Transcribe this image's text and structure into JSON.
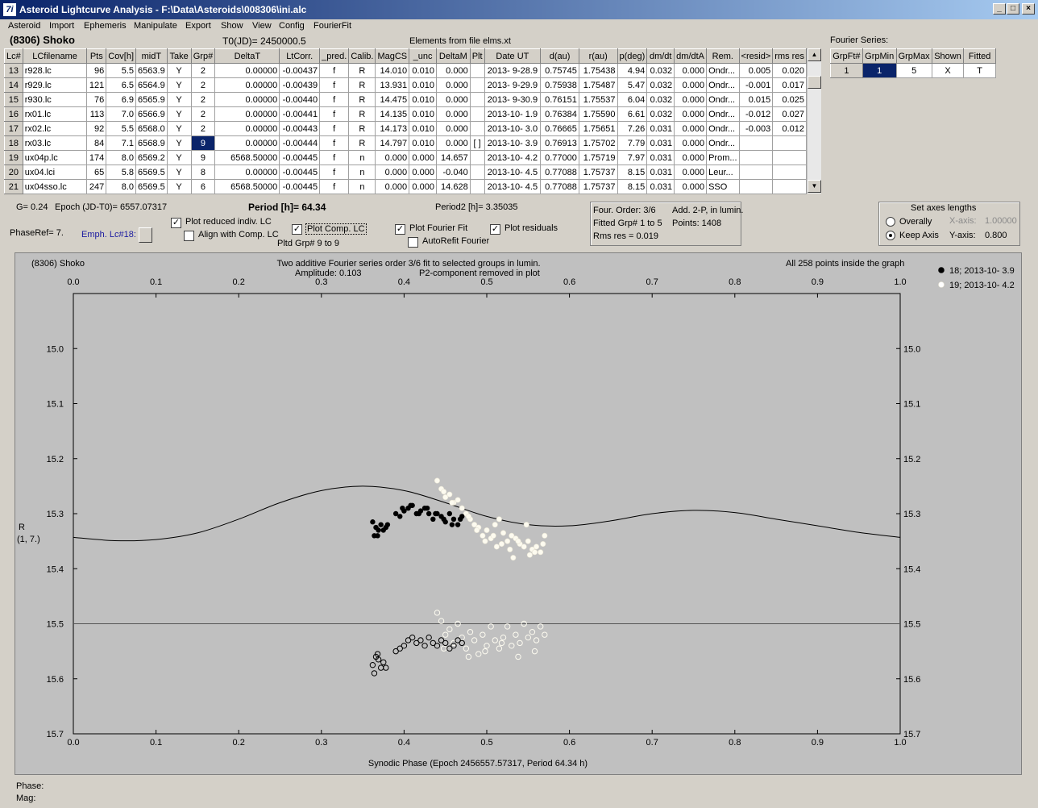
{
  "window": {
    "title": "Asteroid Lightcurve Analysis - F:\\Data\\Asteroids\\008306\\ini.alc",
    "icon_glyph": "7i"
  },
  "menu": [
    "Asteroid",
    "Import",
    "Ephemeris",
    "Manipulate",
    "Export",
    "Show",
    "View",
    "Config",
    "FourierFit"
  ],
  "header": {
    "asteroid": "(8306) Shoko",
    "t0": "T0(JD)= 2450000.5",
    "elements": "Elements from file elms.xt",
    "fourier_series_label": "Fourier Series:"
  },
  "lc_table": {
    "columns": [
      "Lc#",
      "LCfilename",
      "Pts",
      "Cov[h]",
      "midT",
      "Take",
      "Grp#",
      "DeltaT",
      "LtCorr.",
      "_pred.",
      "Calib.",
      "MagCS",
      "_unc",
      "DeltaM",
      "Plt",
      "Date UT",
      "d(au)",
      "r(au)",
      "p(deg)",
      "dm/dt",
      "dm/dtA",
      "Rem.",
      "<resid>",
      "rms res"
    ],
    "rows": [
      [
        "13",
        "r928.lc",
        "96",
        "5.5",
        "6563.9",
        "Y",
        "2",
        "0.00000",
        "-0.00437",
        "f",
        "R",
        "14.010",
        "0.010",
        "0.000",
        "",
        "2013- 9-28.9",
        "0.75745",
        "1.75438",
        "4.94",
        "0.032",
        "0.000",
        "Ondr...",
        "0.005",
        "0.020"
      ],
      [
        "14",
        "r929.lc",
        "121",
        "6.5",
        "6564.9",
        "Y",
        "2",
        "0.00000",
        "-0.00439",
        "f",
        "R",
        "13.931",
        "0.010",
        "0.000",
        "",
        "2013- 9-29.9",
        "0.75938",
        "1.75487",
        "5.47",
        "0.032",
        "0.000",
        "Ondr...",
        "-0.001",
        "0.017"
      ],
      [
        "15",
        "r930.lc",
        "76",
        "6.9",
        "6565.9",
        "Y",
        "2",
        "0.00000",
        "-0.00440",
        "f",
        "R",
        "14.475",
        "0.010",
        "0.000",
        "",
        "2013- 9-30.9",
        "0.76151",
        "1.75537",
        "6.04",
        "0.032",
        "0.000",
        "Ondr...",
        "0.015",
        "0.025"
      ],
      [
        "16",
        "rx01.lc",
        "113",
        "7.0",
        "6566.9",
        "Y",
        "2",
        "0.00000",
        "-0.00441",
        "f",
        "R",
        "14.135",
        "0.010",
        "0.000",
        "",
        "2013-10- 1.9",
        "0.76384",
        "1.75590",
        "6.61",
        "0.032",
        "0.000",
        "Ondr...",
        "-0.012",
        "0.027"
      ],
      [
        "17",
        "rx02.lc",
        "92",
        "5.5",
        "6568.0",
        "Y",
        "2",
        "0.00000",
        "-0.00443",
        "f",
        "R",
        "14.173",
        "0.010",
        "0.000",
        "",
        "2013-10- 3.0",
        "0.76665",
        "1.75651",
        "7.26",
        "0.031",
        "0.000",
        "Ondr...",
        "-0.003",
        "0.012"
      ],
      [
        "18",
        "rx03.lc",
        "84",
        "7.1",
        "6568.9",
        "Y",
        "9",
        "0.00000",
        "-0.00444",
        "f",
        "R",
        "14.797",
        "0.010",
        "0.000",
        "[ ]",
        "2013-10- 3.9",
        "0.76913",
        "1.75702",
        "7.79",
        "0.031",
        "0.000",
        "Ondr...",
        "",
        ""
      ],
      [
        "19",
        "ux04p.lc",
        "174",
        "8.0",
        "6569.2",
        "Y",
        "9",
        "6568.50000",
        "-0.00445",
        "f",
        "n",
        "0.000",
        "0.000",
        "14.657",
        "",
        "2013-10- 4.2",
        "0.77000",
        "1.75719",
        "7.97",
        "0.031",
        "0.000",
        "Prom...",
        "",
        ""
      ],
      [
        "20",
        "ux04.lci",
        "65",
        "5.8",
        "6569.5",
        "Y",
        "8",
        "0.00000",
        "-0.00445",
        "f",
        "n",
        "0.000",
        "0.000",
        "-0.040",
        "",
        "2013-10- 4.5",
        "0.77088",
        "1.75737",
        "8.15",
        "0.031",
        "0.000",
        "Leur...",
        "",
        ""
      ],
      [
        "21",
        "ux04sso.lc",
        "247",
        "8.0",
        "6569.5",
        "Y",
        "6",
        "6568.50000",
        "-0.00445",
        "f",
        "n",
        "0.000",
        "0.000",
        "14.628",
        "",
        "2013-10- 4.5",
        "0.77088",
        "1.75737",
        "8.15",
        "0.031",
        "0.000",
        "SSO",
        "",
        ""
      ]
    ]
  },
  "fourier_table": {
    "columns": [
      "GrpFt#",
      "GrpMin",
      "GrpMax",
      "Shown",
      "Fitted"
    ],
    "rows": [
      [
        "1",
        "1",
        "5",
        "X",
        "T"
      ]
    ]
  },
  "params": {
    "g": "G= 0.24",
    "epoch": "Epoch (JD-T0)= 6557.07317",
    "period": "Period [h]= 64.34",
    "period2": "Period2 [h]= 3.35035",
    "phase_ref": "PhaseRef= 7.",
    "emph_lc": "Emph. Lc#18:",
    "pltd_grp": "Pltd Grp#  9   to   9"
  },
  "checkboxes": {
    "plot_reduced": {
      "label": "Plot reduced indiv. LC",
      "checked": true
    },
    "align_comp": {
      "label": "Align with Comp. LC",
      "checked": false
    },
    "plot_comp": {
      "label": "Plot Comp. LC",
      "checked": true
    },
    "plot_fourier": {
      "label": "Plot Fourier Fit",
      "checked": true
    },
    "autorefit": {
      "label": "AutoRefit Fourier",
      "checked": false
    },
    "plot_residuals": {
      "label": "Plot residuals",
      "checked": true
    }
  },
  "fit_info": {
    "line1a": "Four. Order:  3/6",
    "line1b": "Add. 2-P, in lumin.",
    "line2a": "Fitted Grp# 1 to 5",
    "line2b": "Points: 1408",
    "line3": "Rms res      = 0.019"
  },
  "axes_box": {
    "title": "Set axes lengths",
    "overally": "Overally",
    "keep_axis": "Keep Axis",
    "x_axis_label": "X-axis:",
    "x_axis_value": "1.00000",
    "y_axis_label": "Y-axis:",
    "y_axis_value": "0.800"
  },
  "plot": {
    "name": "(8306) Shoko",
    "subtitle1": "Two additive Fourier series order 3/6 fit to selected groups in lumin.",
    "amplitude": "Amplitude: 0.103",
    "subtitle2": "P2-component removed in plot",
    "inside": "All 258 points inside the graph",
    "legend": [
      {
        "label": "18; 2013-10- 3.9",
        "color": "#000000"
      },
      {
        "label": "19; 2013-10- 4.2",
        "color": "#ffffff"
      }
    ],
    "ylabel_line1": "R",
    "ylabel_line2": "(1, 7.)",
    "xlabel": "Synodic Phase (Epoch 2456557.57317, Period 64.34 h)",
    "phase_label": "Phase:",
    "mag_label": "Mag:"
  },
  "chart_data": {
    "type": "scatter",
    "xlim": [
      0.0,
      1.0
    ],
    "ylim": [
      15.7,
      14.9
    ],
    "xticks": [
      "0.0",
      "0.1",
      "0.2",
      "0.3",
      "0.4",
      "0.5",
      "0.6",
      "0.7",
      "0.8",
      "0.9",
      "1.0"
    ],
    "yticks": [
      "15.0",
      "15.1",
      "15.2",
      "15.3",
      "15.4",
      "15.5",
      "15.6",
      "15.7"
    ],
    "fourier_curve": {
      "x": [
        0.0,
        0.05,
        0.1,
        0.15,
        0.2,
        0.25,
        0.3,
        0.35,
        0.4,
        0.45,
        0.5,
        0.55,
        0.6,
        0.65,
        0.7,
        0.75,
        0.8,
        0.85,
        0.9,
        0.95,
        1.0
      ],
      "y": [
        15.343,
        15.349,
        15.347,
        15.335,
        15.31,
        15.28,
        15.258,
        15.25,
        15.258,
        15.28,
        15.305,
        15.32,
        15.322,
        15.313,
        15.3,
        15.294,
        15.298,
        15.31,
        15.322,
        15.334,
        15.343
      ]
    },
    "residual_line": 15.5,
    "series": [
      {
        "name": "18; 2013-10- 3.9",
        "x": [
          0.362,
          0.366,
          0.369,
          0.372,
          0.375,
          0.378,
          0.364,
          0.368,
          0.38,
          0.39,
          0.395,
          0.4,
          0.405,
          0.41,
          0.415,
          0.42,
          0.425,
          0.43,
          0.435,
          0.44,
          0.445,
          0.45,
          0.455,
          0.46,
          0.465,
          0.47,
          0.398,
          0.408,
          0.418,
          0.428,
          0.438,
          0.448,
          0.458,
          0.468
        ],
        "y": [
          15.315,
          15.325,
          15.33,
          15.32,
          15.33,
          15.325,
          15.34,
          15.34,
          15.32,
          15.3,
          15.305,
          15.295,
          15.29,
          15.285,
          15.3,
          15.295,
          15.29,
          15.3,
          15.31,
          15.3,
          15.305,
          15.315,
          15.3,
          15.31,
          15.32,
          15.305,
          15.29,
          15.285,
          15.3,
          15.29,
          15.3,
          15.31,
          15.32,
          15.31
        ]
      },
      {
        "name": "19; 2013-10- 4.2",
        "x": [
          0.44,
          0.445,
          0.45,
          0.455,
          0.46,
          0.465,
          0.47,
          0.475,
          0.48,
          0.485,
          0.49,
          0.495,
          0.5,
          0.505,
          0.51,
          0.515,
          0.52,
          0.525,
          0.53,
          0.535,
          0.54,
          0.545,
          0.55,
          0.555,
          0.56,
          0.565,
          0.57,
          0.448,
          0.458,
          0.478,
          0.488,
          0.498,
          0.508,
          0.518,
          0.528,
          0.538,
          0.548,
          0.558,
          0.568,
          0.512,
          0.532,
          0.552
        ],
        "y": [
          15.24,
          15.255,
          15.27,
          15.265,
          15.28,
          15.275,
          15.29,
          15.3,
          15.31,
          15.32,
          15.325,
          15.34,
          15.33,
          15.345,
          15.32,
          15.31,
          15.335,
          15.35,
          15.34,
          15.345,
          15.355,
          15.36,
          15.35,
          15.365,
          15.36,
          15.37,
          15.34,
          15.26,
          15.28,
          15.305,
          15.33,
          15.35,
          15.34,
          15.355,
          15.365,
          15.35,
          15.32,
          15.37,
          15.355,
          15.36,
          15.38,
          15.375
        ]
      }
    ],
    "residual_series": [
      {
        "name": "18; 2013-10- 3.9",
        "x": [
          0.362,
          0.366,
          0.369,
          0.372,
          0.375,
          0.378,
          0.364,
          0.368,
          0.39,
          0.395,
          0.4,
          0.405,
          0.41,
          0.415,
          0.42,
          0.425,
          0.43,
          0.435,
          0.44,
          0.445,
          0.45,
          0.455,
          0.46,
          0.465,
          0.47
        ],
        "y": [
          15.575,
          15.56,
          15.565,
          15.58,
          15.57,
          15.58,
          15.59,
          15.555,
          15.55,
          15.545,
          15.54,
          15.53,
          15.525,
          15.535,
          15.53,
          15.54,
          15.525,
          15.535,
          15.54,
          15.53,
          15.535,
          15.545,
          15.54,
          15.53,
          15.535
        ]
      },
      {
        "name": "19; 2013-10- 4.2",
        "x": [
          0.44,
          0.445,
          0.45,
          0.455,
          0.46,
          0.465,
          0.47,
          0.475,
          0.48,
          0.485,
          0.49,
          0.495,
          0.5,
          0.505,
          0.51,
          0.515,
          0.52,
          0.525,
          0.53,
          0.535,
          0.54,
          0.545,
          0.55,
          0.555,
          0.56,
          0.565,
          0.57,
          0.448,
          0.478,
          0.498,
          0.518,
          0.538,
          0.558
        ],
        "y": [
          15.48,
          15.495,
          15.52,
          15.51,
          15.535,
          15.5,
          15.525,
          15.545,
          15.515,
          15.53,
          15.555,
          15.52,
          15.54,
          15.505,
          15.53,
          15.545,
          15.525,
          15.505,
          15.54,
          15.52,
          15.535,
          15.5,
          15.525,
          15.515,
          15.53,
          15.505,
          15.52,
          15.545,
          15.56,
          15.55,
          15.535,
          15.56,
          15.55
        ]
      }
    ]
  }
}
